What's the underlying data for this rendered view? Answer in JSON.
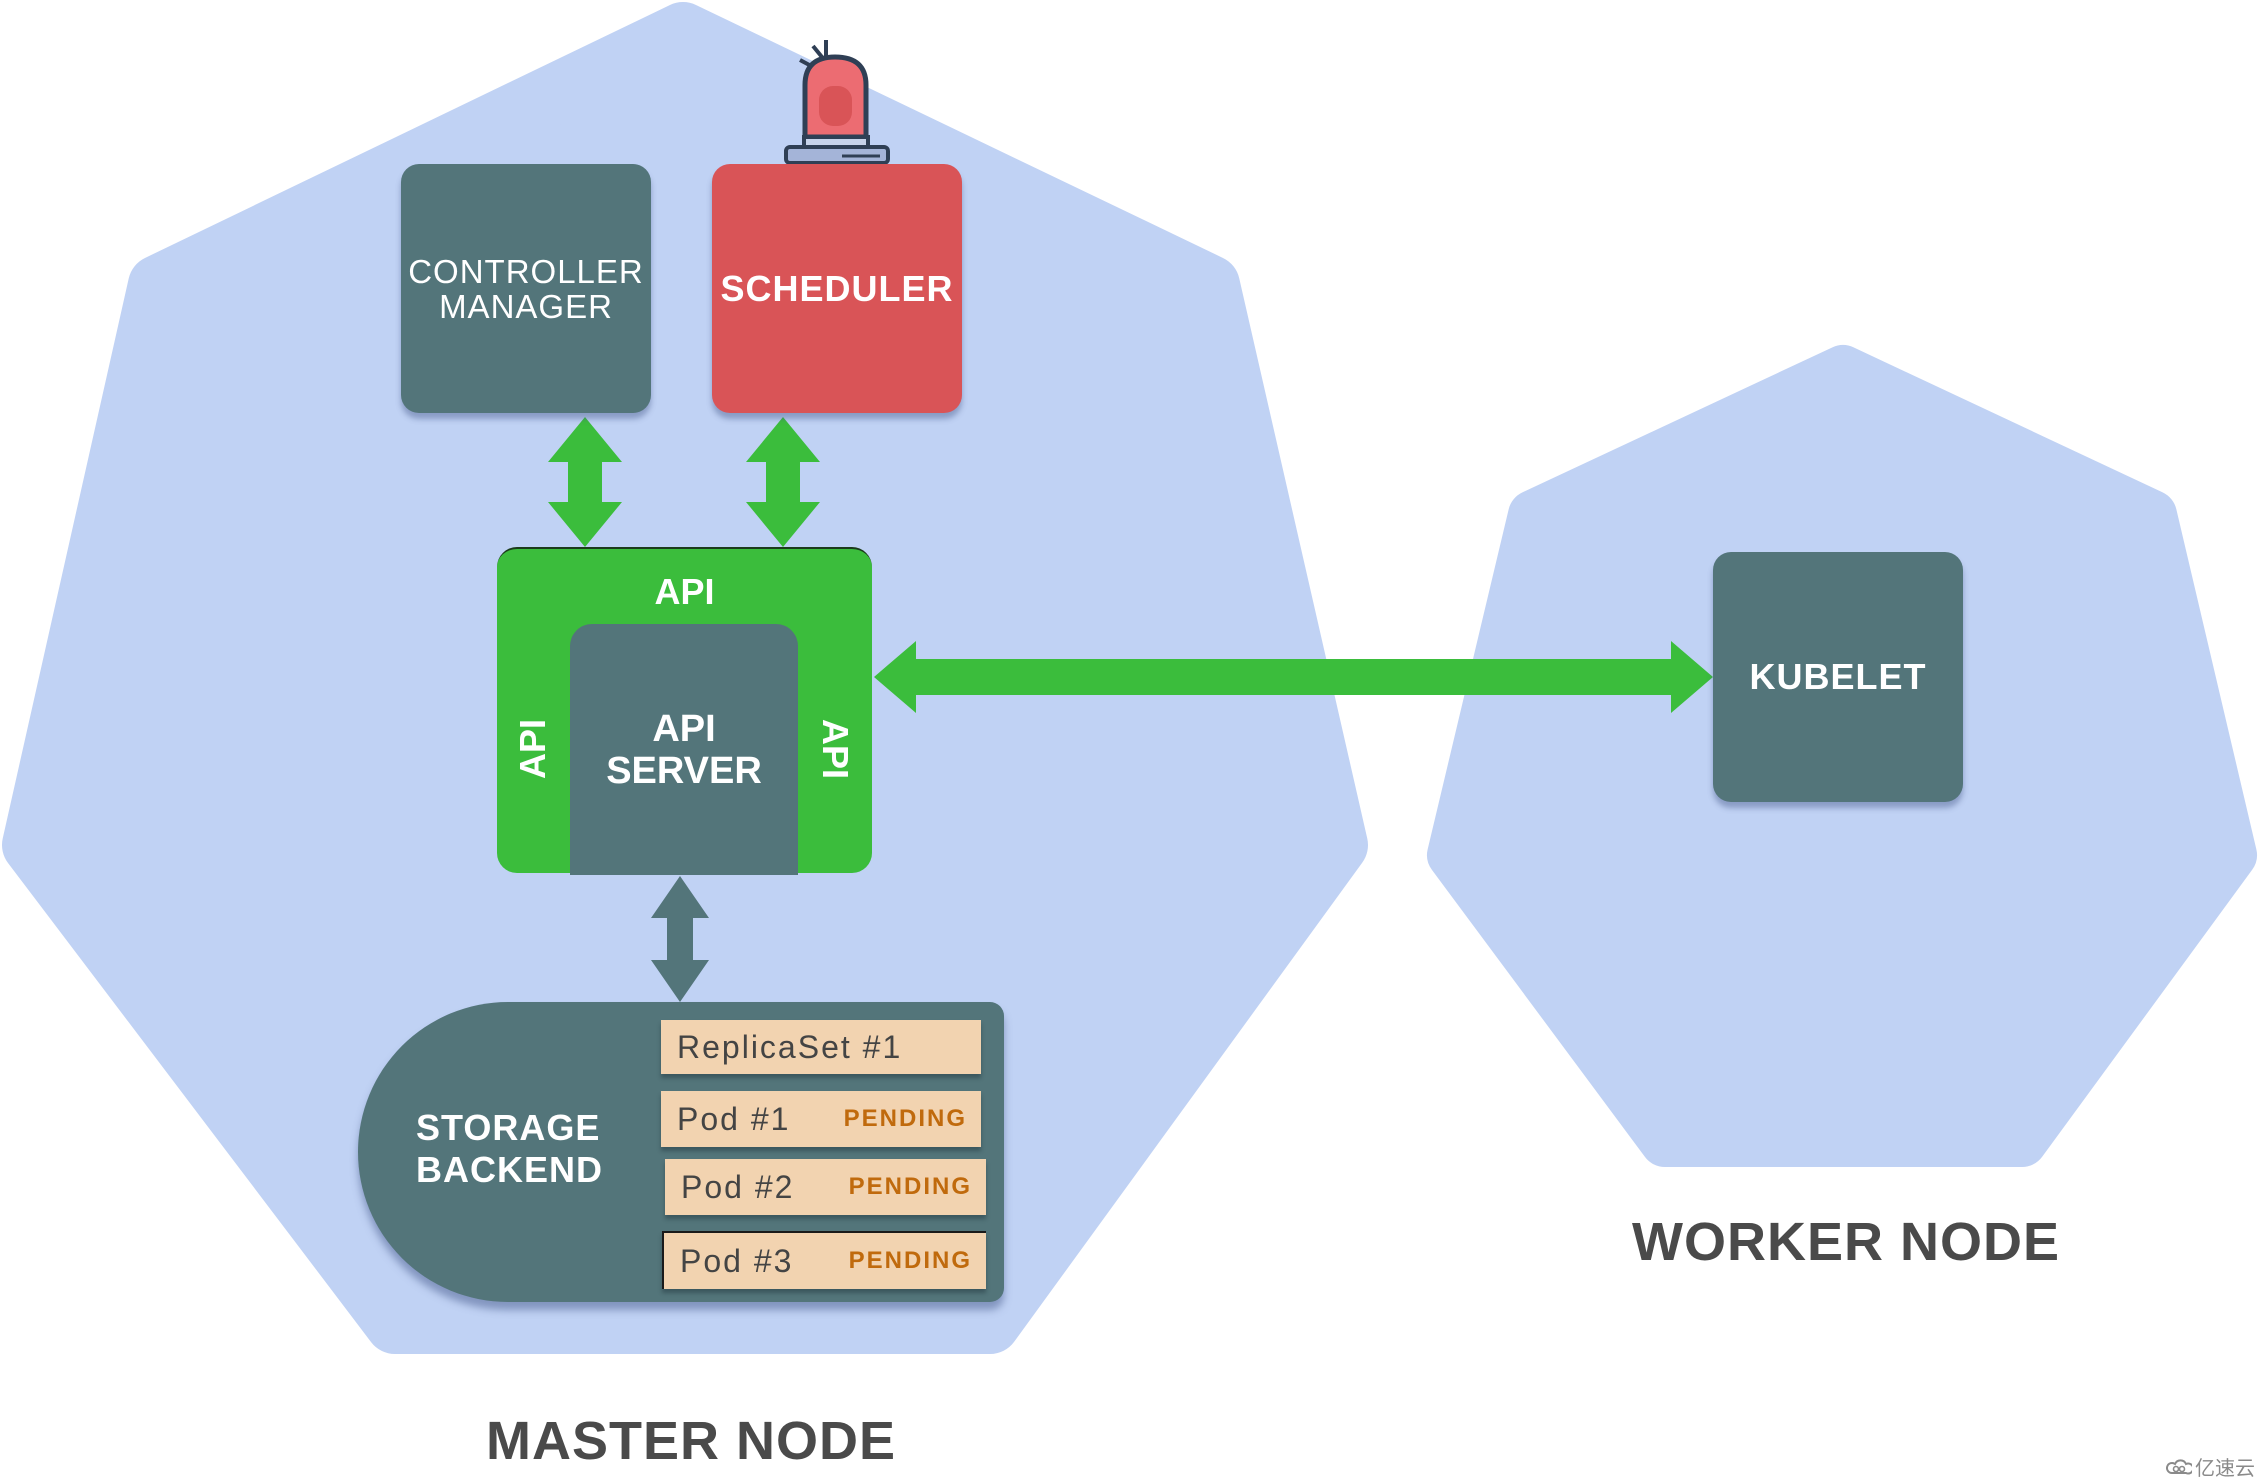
{
  "colors": {
    "node_fill": "#c0d2f4",
    "component_teal": "#53757a",
    "scheduler_red": "#d95457",
    "api_green": "#3bbd3c",
    "row_fill": "#f2d3b0",
    "status_orange": "#c06a0d",
    "label_gray": "#4a4a4a"
  },
  "master_node": {
    "label": "MASTER NODE",
    "controller_manager": {
      "line1": "CONTROLLER",
      "line2": "MANAGER"
    },
    "scheduler": {
      "label": "SCHEDULER",
      "alert_icon": "siren-icon"
    },
    "api_server": {
      "api_top": "API",
      "api_left": "API",
      "api_right": "API",
      "line1": "API",
      "line2": "SERVER"
    },
    "storage_backend": {
      "line1": "STORAGE",
      "line2": "BACKEND",
      "rows": [
        {
          "title": "ReplicaSet #1",
          "status": ""
        },
        {
          "title": "Pod #1",
          "status": "PENDING"
        },
        {
          "title": "Pod #2",
          "status": "PENDING"
        },
        {
          "title": "Pod #3",
          "status": "PENDING"
        }
      ]
    }
  },
  "worker_node": {
    "label": "WORKER NODE",
    "kubelet": {
      "label": "KUBELET"
    }
  },
  "connections": [
    {
      "from": "controller_manager",
      "to": "api_server",
      "type": "bidirectional"
    },
    {
      "from": "scheduler",
      "to": "api_server",
      "type": "bidirectional"
    },
    {
      "from": "api_server",
      "to": "storage_backend",
      "type": "bidirectional"
    },
    {
      "from": "api_server",
      "to": "kubelet",
      "type": "bidirectional"
    }
  ],
  "watermark": {
    "text": "亿速云",
    "icon": "cloud-logo-icon"
  }
}
